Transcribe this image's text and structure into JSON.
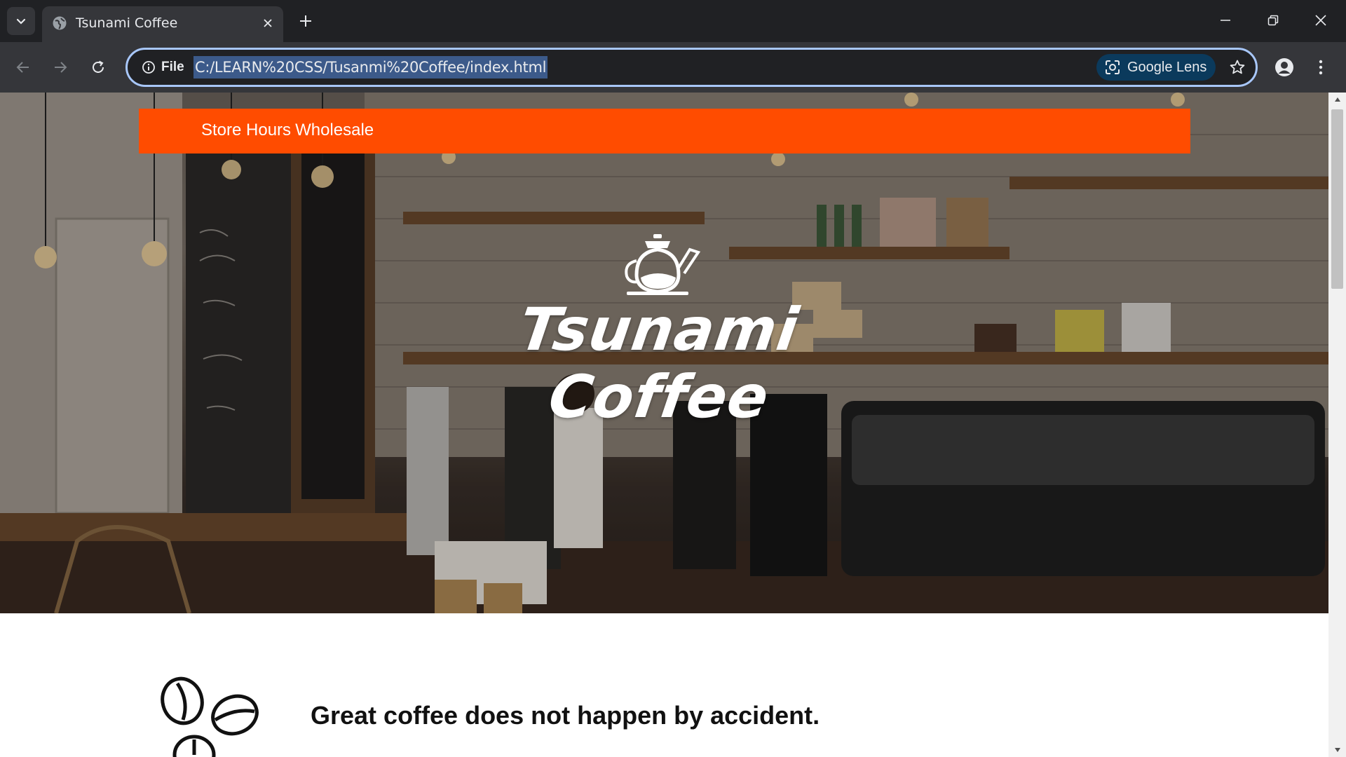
{
  "browser": {
    "tab_title": "Tsunami Coffee",
    "site_info_label": "File",
    "url": "C:/LEARN%20CSS/Tusanmi%20Coffee/index.html",
    "lens_label": "Google Lens"
  },
  "page": {
    "nav": [
      "Store Hours",
      "Wholesale"
    ],
    "brand": {
      "line1": "Tsunami",
      "line2": "Coffee"
    },
    "headline": "Great coffee does not happen by accident.",
    "accent_color": "#ff4c00"
  }
}
